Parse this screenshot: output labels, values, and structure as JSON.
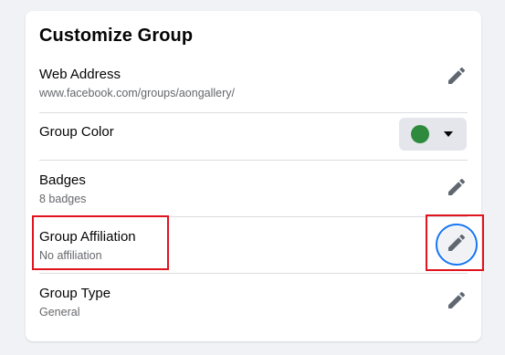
{
  "card": {
    "title": "Customize Group"
  },
  "rows": [
    {
      "label": "Web Address",
      "value": "www.facebook.com/groups/aongallery/",
      "action": "pencil-icon"
    },
    {
      "label": "Group Color",
      "value": "",
      "action": "color-dropdown",
      "selected_color": "#2e8b3e"
    },
    {
      "label": "Badges",
      "value": "8 badges",
      "action": "pencil-icon"
    },
    {
      "label": "Group Affiliation",
      "value": "No affiliation",
      "action": "pencil-icon",
      "highlighted": true,
      "focused": true
    },
    {
      "label": "Group Type",
      "value": "General",
      "action": "pencil-icon"
    }
  ],
  "colors": {
    "page_bg": "#f0f2f5",
    "card_bg": "#ffffff",
    "icon": "#606770",
    "focus_ring": "#1877f2",
    "highlight": "#e0141e"
  }
}
